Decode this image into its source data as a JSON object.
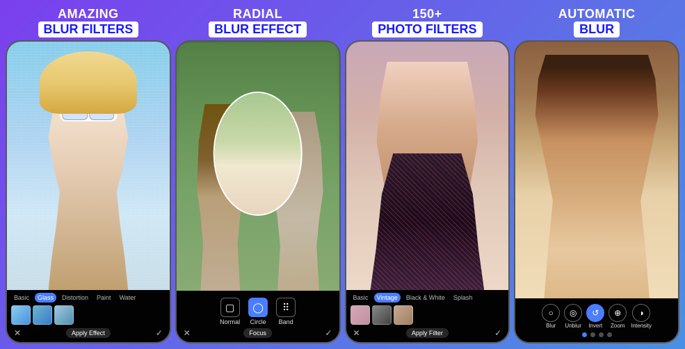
{
  "panels": [
    {
      "id": "blur-filters",
      "title_line1": "AMAZING",
      "title_line2": "BLUR FILTERS",
      "filter_tabs": [
        "Basic",
        "Glass",
        "Distortion",
        "Paint",
        "Water"
      ],
      "active_tab": "Glass",
      "bottom_label": "Apply Effect",
      "tools": []
    },
    {
      "id": "radial-blur",
      "title_line1": "RADIAL",
      "title_line2": "BLUR EFFECT",
      "filter_tabs": [],
      "active_tab": "",
      "bottom_label": "Focus",
      "tools": [
        {
          "icon": "▢",
          "label": "Normal",
          "active": false
        },
        {
          "icon": "◯",
          "label": "Circle",
          "active": true
        },
        {
          "icon": "⠿",
          "label": "Band",
          "active": false
        }
      ]
    },
    {
      "id": "photo-filters",
      "title_line1": "150+",
      "title_line2": "PHOTO FILTERS",
      "filter_tabs": [
        "Basic",
        "Vintage",
        "Black & White",
        "Splash"
      ],
      "active_tab": "Vintage",
      "bottom_label": "Apply Filter",
      "tools": []
    },
    {
      "id": "automatic-blur",
      "title_line1": "AUTOMATIC",
      "title_line2": "BLUR",
      "filter_tabs": [],
      "active_tab": "",
      "bottom_label": "",
      "tools": [
        {
          "icon": "○",
          "label": "Blur",
          "active": false
        },
        {
          "icon": "◎",
          "label": "Unblur",
          "active": false
        },
        {
          "icon": "↺",
          "label": "Invert",
          "active": true
        },
        {
          "icon": "⊕",
          "label": "Zoom",
          "active": false
        },
        {
          "icon": "◑",
          "label": "Intensity",
          "active": false
        }
      ]
    }
  ],
  "colors": {
    "active_tab_bg": "#4A7EFF",
    "gradient_start": "#7B3FEE",
    "gradient_end": "#4A90E2"
  }
}
